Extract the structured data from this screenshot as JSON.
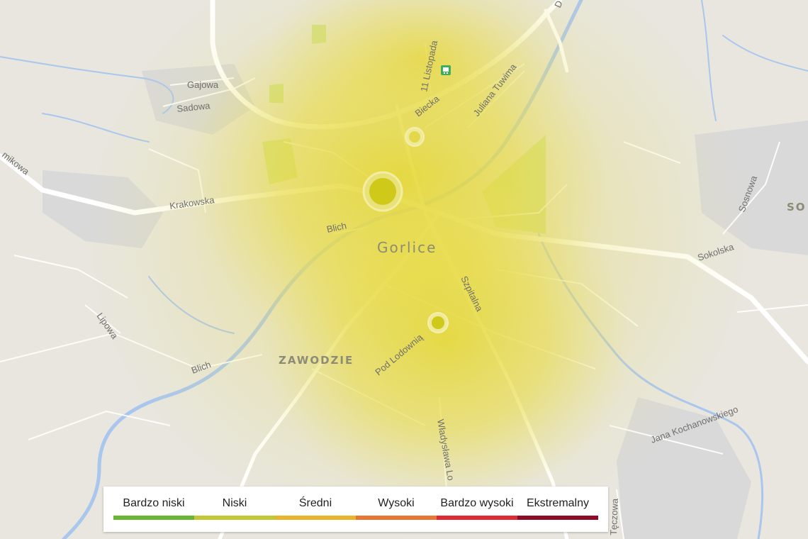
{
  "map": {
    "city_label": "Gorlice",
    "district_label": "ZAWODZIE",
    "partial_label_right": "SO",
    "partial_label_top": "D",
    "streets": {
      "krakowska": "Krakowska",
      "blich_center": "Blich",
      "blich_south": "Blich",
      "gajowa": "Gajowa",
      "sadowa": "Sadowa",
      "listopada": "11 Listopada",
      "biecka": "Biecka",
      "tuwima": "Juliana Tuwima",
      "szpitalna": "Szpitalna",
      "podlodownia": "Pod Lodownią",
      "wladyslawa": "Władysława Lo",
      "lipowa": "Lipowa",
      "sokolska": "Sokolska",
      "sosnowa": "Sosnowa",
      "kochanowskiego": "Jana Kochanowskiego",
      "teczowa": "Tęczowa",
      "mikowa": "mikowa"
    },
    "sensors": [
      {
        "name": "sensor-large",
        "level": "Niski"
      },
      {
        "name": "sensor-north",
        "level": "Niski"
      },
      {
        "name": "sensor-south",
        "level": "Niski"
      }
    ],
    "icons": [
      "train-station-icon"
    ]
  },
  "legend": {
    "items": [
      {
        "label": "Bardzo niski",
        "color": "#6ab536"
      },
      {
        "label": "Niski",
        "color": "#c3c736"
      },
      {
        "label": "Średni",
        "color": "#e6b52b"
      },
      {
        "label": "Wysoki",
        "color": "#e67633"
      },
      {
        "label": "Bardzo wysoki",
        "color": "#dd2a35"
      },
      {
        "label": "Ekstremalny",
        "color": "#8c0c28"
      }
    ]
  }
}
